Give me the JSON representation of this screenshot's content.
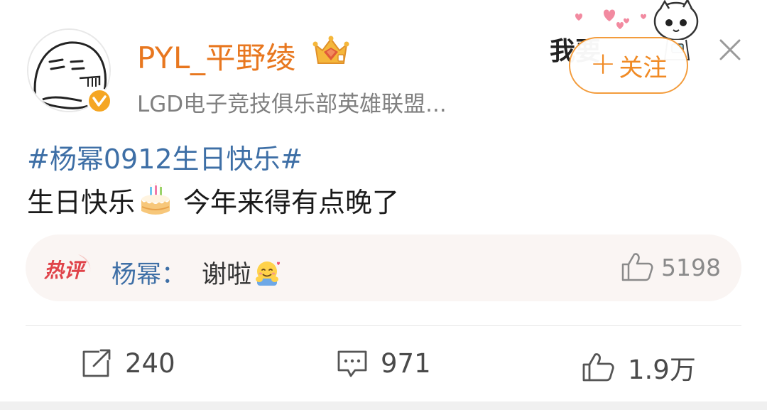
{
  "user": {
    "name": "PYL_平野绫",
    "bio": "LGD电子竞技俱乐部英雄联盟..."
  },
  "stickers": {
    "text": "我要"
  },
  "follow": {
    "plus": "+",
    "label": "关注"
  },
  "post": {
    "topic": "#杨幂0912生日快乐#",
    "text_before": "生日快乐",
    "text_after": "今年来得有点晚了"
  },
  "hot_comment": {
    "badge": "热评",
    "author": "杨幂：",
    "text": "谢啦",
    "likes": "5198"
  },
  "actions": {
    "reposts": "240",
    "comments": "971",
    "likes": "1.9万"
  },
  "colors": {
    "username": "#e8771f",
    "topic": "#3e6fa6",
    "follow_border": "#f39c3c",
    "hot_bg": "#faf5f3",
    "hot_badge": "#e0434a"
  }
}
